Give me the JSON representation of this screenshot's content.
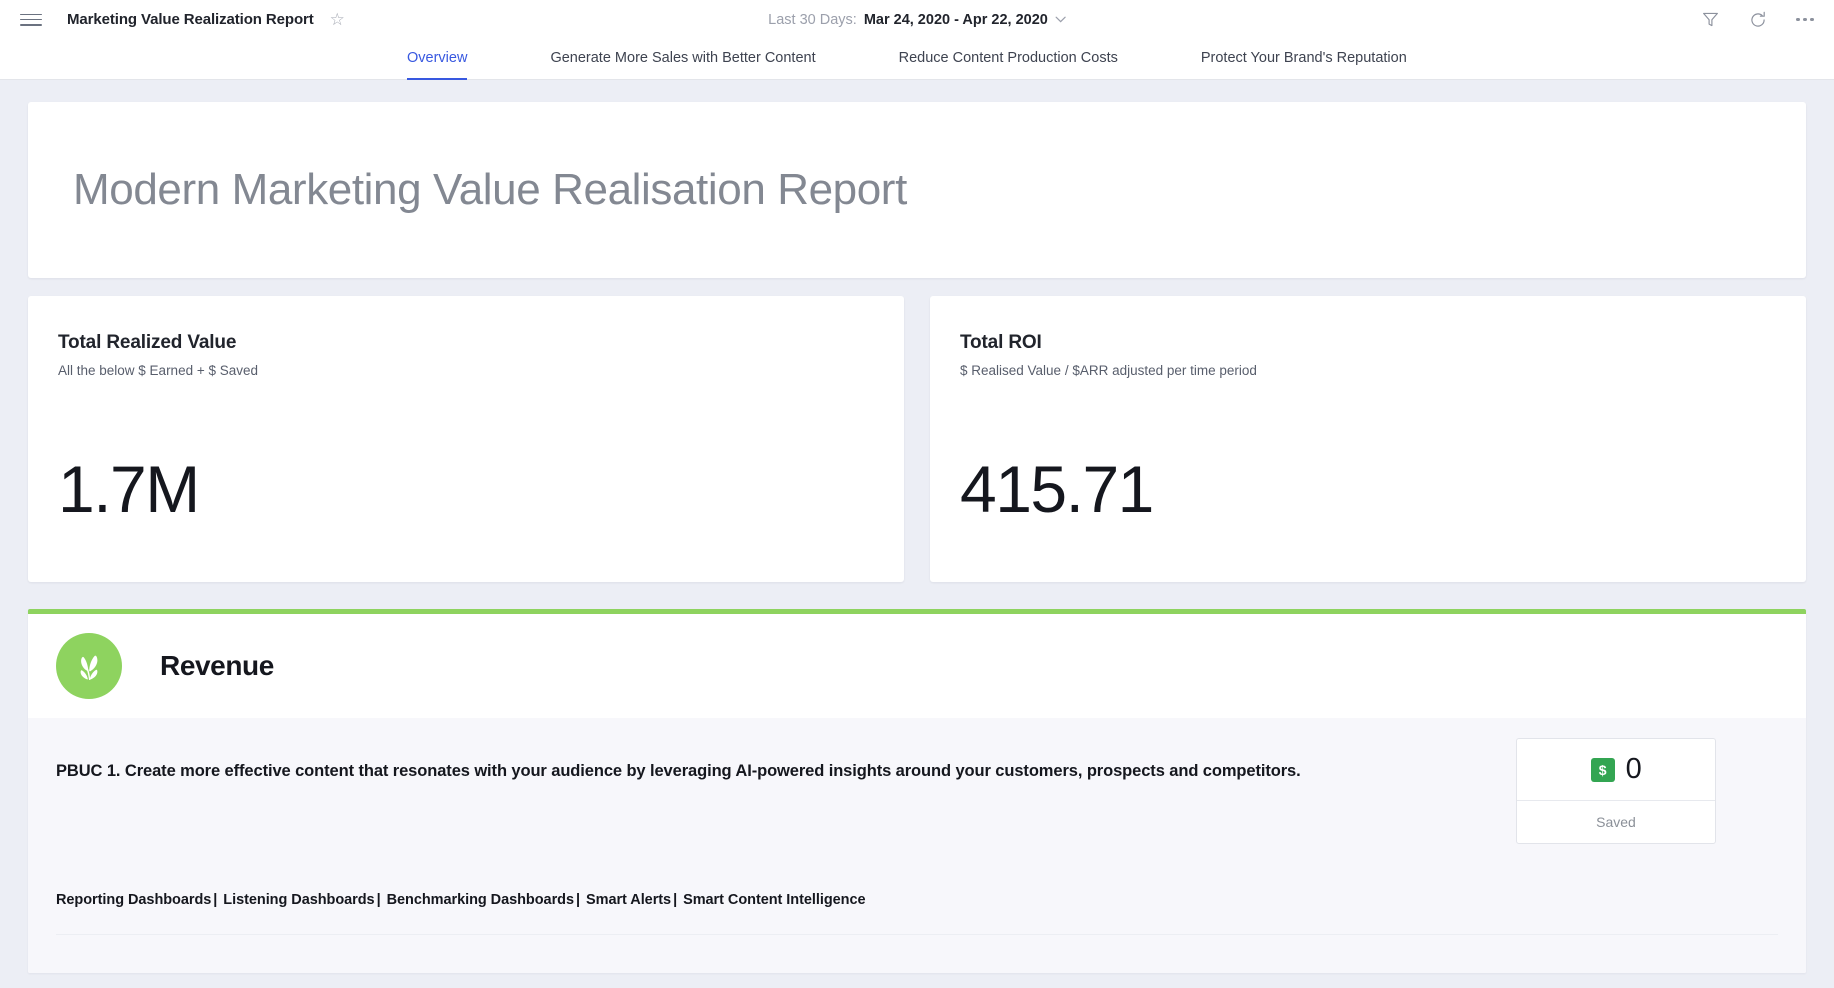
{
  "topbar": {
    "menu_icon": "hamburger-icon",
    "title": "Marketing Value Realization Report",
    "favorite_icon": "star-icon",
    "daterange": {
      "label": "Last 30 Days:",
      "value": "Mar 24, 2020 - Apr 22, 2020",
      "caret": "⌄"
    },
    "actions": [
      {
        "name": "filter-icon"
      },
      {
        "name": "refresh-icon"
      },
      {
        "name": "more-options-icon"
      }
    ]
  },
  "tabs": [
    {
      "label": "Overview",
      "active": true
    },
    {
      "label": "Generate More Sales with Better Content",
      "active": false
    },
    {
      "label": "Reduce Content Production Costs",
      "active": false
    },
    {
      "label": "Protect Your Brand's Reputation",
      "active": false
    }
  ],
  "hero": {
    "title": "Modern Marketing Value Realisation Report"
  },
  "kpis": [
    {
      "title": "Total Realized Value",
      "subtitle": "All the below $ Earned + $ Saved",
      "value": "1.7M"
    },
    {
      "title": "Total ROI",
      "subtitle": "$ Realised Value / $ARR adjusted per time period",
      "value": "415.71"
    }
  ],
  "section": {
    "accent_color": "#8ed35f",
    "logo_icon": "sprout-leaf-icon",
    "name": "Revenue",
    "pbuc_text": "PBUC 1. Create more effective content that resonates with your audience by leveraging AI-powered insights around your customers, prospects and competitors.",
    "metric": {
      "badge_icon": "dollar-badge-icon",
      "badge_text": "$",
      "badge_color": "#33a552",
      "value": "0",
      "label": "Saved"
    },
    "links": [
      "Reporting Dashboards",
      "Listening Dashboards",
      "Benchmarking Dashboards",
      "Smart Alerts",
      "Smart Content Intelligence"
    ],
    "link_separator": "|"
  }
}
